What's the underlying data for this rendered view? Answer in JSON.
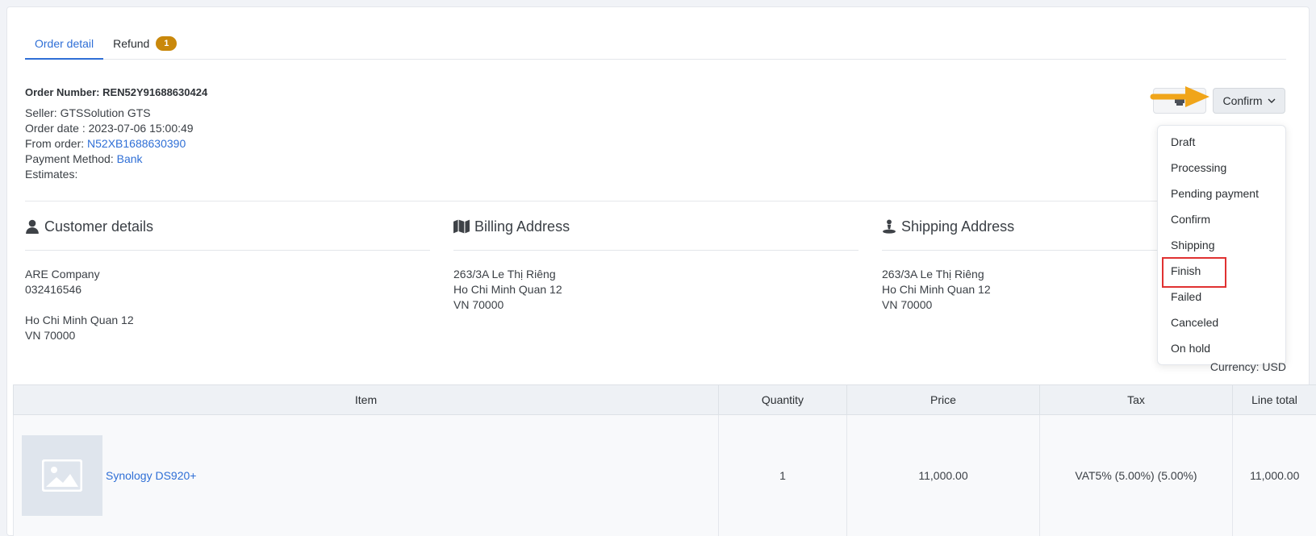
{
  "tabs": [
    {
      "label": "Order detail",
      "active": true
    },
    {
      "label": "Refund",
      "badge": "1"
    }
  ],
  "order": {
    "number_label": "Order Number: REN52Y91688630424",
    "seller": "Seller: GTSSolution GTS",
    "date": "Order date : 2023-07-06 15:00:49",
    "from_order_label": "From order: ",
    "from_order_value": "N52XB1688630390",
    "payment_label": "Payment Method: ",
    "payment_value": "Bank",
    "estimates": "Estimates:"
  },
  "customer": {
    "title": "Customer details",
    "icon": "user-icon",
    "lines": [
      "ARE Company",
      "032416546",
      "",
      "Ho Chi Minh Quan 12",
      "VN 70000"
    ]
  },
  "billing": {
    "title": "Billing Address",
    "icon": "map-icon",
    "lines": [
      "263/3A Le Thị Riêng",
      "Ho Chi Minh Quan 12",
      "VN 70000"
    ]
  },
  "shipping": {
    "title": "Shipping Address",
    "icon": "map-pin-user-icon",
    "lines": [
      "263/3A Le Thị Riêng",
      "Ho Chi Minh Quan 12",
      "VN 70000"
    ]
  },
  "actions": {
    "confirm_label": "Confirm",
    "status_options": [
      "Draft",
      "Processing",
      "Pending payment",
      "Confirm",
      "Shipping",
      "Finish",
      "Failed",
      "Canceled",
      "On hold"
    ],
    "highlighted_option": "Finish"
  },
  "currency": "Currency: USD",
  "table": {
    "headers": [
      "Item",
      "Quantity",
      "Price",
      "Tax",
      "Line total"
    ],
    "rows": [
      {
        "item": "Synology DS920+",
        "quantity": "1",
        "price": "11,000.00",
        "tax": "VAT5% (5.00%) (5.00%)",
        "line_total": "11,000.00"
      }
    ]
  },
  "colors": {
    "accent": "#2f6fd6",
    "badge": "#c9880b",
    "arrow": "#f0a51a",
    "highlight_box": "#e03131"
  }
}
